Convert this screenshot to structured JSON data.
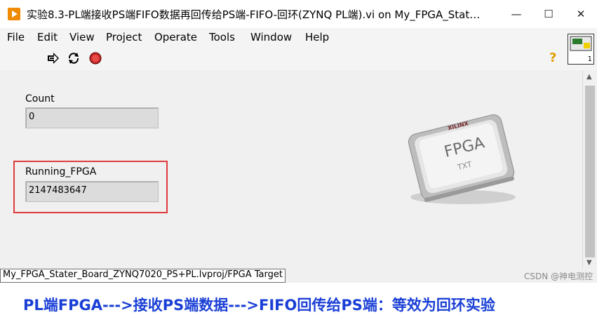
{
  "window": {
    "title": "实验8.3-PL端接收PS端FIFO数据再回传给PS端-FIFO-回环(ZYNQ PL端).vi on My_FPGA_Stat…",
    "minimize_glyph": "—",
    "maximize_glyph": "☐",
    "close_glyph": "✕"
  },
  "menu": {
    "items": [
      "File",
      "Edit",
      "View",
      "Project",
      "Operate",
      "Tools",
      "Window",
      "Help"
    ]
  },
  "toolbar": {
    "icons": [
      "run-arrow-icon",
      "run-continuously-icon",
      "abort-stop-icon",
      "help-icon",
      "vi-connector-icon"
    ],
    "help_glyph": "?",
    "vi_icon_number": "1"
  },
  "panel": {
    "count": {
      "label": "Count",
      "value": "0"
    },
    "running": {
      "label": "Running_FPGA",
      "value": "2147483647"
    },
    "banner": "PL端FPGA--->接收PS端数据--->FIFO回传给PS端：等效为回环实验",
    "chip": {
      "label": "FPGA",
      "sub": "TXT",
      "brand": "XILINX"
    }
  },
  "status": {
    "path": "My_FPGA_Stater_Board_ZYNQ7020_PS+PL.lvproj/FPGA Target",
    "watermark": "CSDN @神电测控"
  },
  "colors": {
    "accent_orange": "#f08a00",
    "banner_blue": "#1a3fd6",
    "highlight_red": "#e03b3b"
  }
}
